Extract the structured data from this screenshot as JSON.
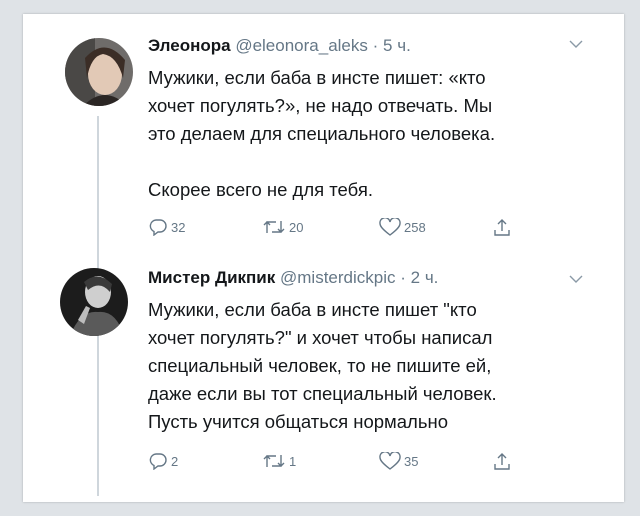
{
  "tweets": [
    {
      "name": "Элеонора",
      "handle": "@eleonora_aleks",
      "dot": "·",
      "time": "5 ч.",
      "text": "Мужики, если баба в инсте пишет: «кто\nхочет погулять?», не надо отвечать. Мы\nэто делаем для специального человека.\n\nСкорее всего не для тебя.",
      "reply_count": "32",
      "retweet_count": "20",
      "like_count": "258"
    },
    {
      "name": "Мистер Дикпик",
      "handle": "@misterdickpic",
      "dot": "·",
      "time": "2 ч.",
      "text": "Мужики, если баба в инсте пишет \"кто\nхочет погулять?\" и хочет чтобы написал\nспециальный человек, то не пишите ей,\nдаже если вы тот специальный человек.\nПусть учится общаться нормально",
      "reply_count": "2",
      "retweet_count": "1",
      "like_count": "35"
    }
  ],
  "icons": {
    "reply": "reply-icon",
    "retweet": "retweet-icon",
    "like": "heart-icon",
    "share": "share-icon",
    "menu": "chevron-down-icon"
  },
  "colors": {
    "text": "#14171a",
    "secondary": "#657786",
    "thread_line": "#cfd6dc"
  }
}
